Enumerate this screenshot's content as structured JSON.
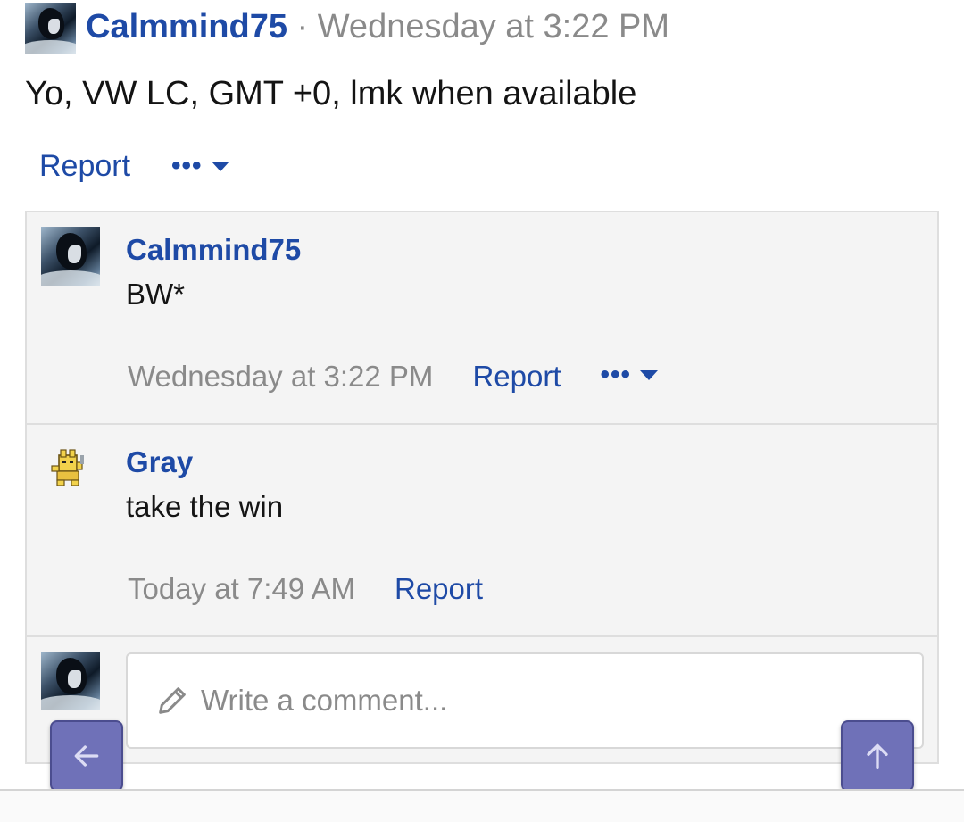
{
  "post": {
    "author": "Calmmind75",
    "separator": "·",
    "timestamp": "Wednesday at 3:22 PM",
    "text": "Yo, VW LC, GMT +0, lmk when available",
    "report_label": "Report",
    "more_label": "•••"
  },
  "comments": [
    {
      "author": "Calmmind75",
      "text": "BW*",
      "timestamp": "Wednesday at 3:22 PM",
      "report_label": "Report",
      "more_label": "•••"
    },
    {
      "author": "Gray",
      "text": "take the win",
      "timestamp": "Today at 7:49 AM",
      "report_label": "Report"
    }
  ],
  "composer": {
    "placeholder": "Write a comment..."
  },
  "colors": {
    "link": "#1e4aa6",
    "muted": "#8a8a8a",
    "fab": "#6f71b8",
    "comment_bg": "#f4f4f4"
  },
  "icons": {
    "back": "arrow-left-icon",
    "top": "arrow-up-icon",
    "compose": "pencil-icon",
    "menu": "caret-down-icon"
  }
}
